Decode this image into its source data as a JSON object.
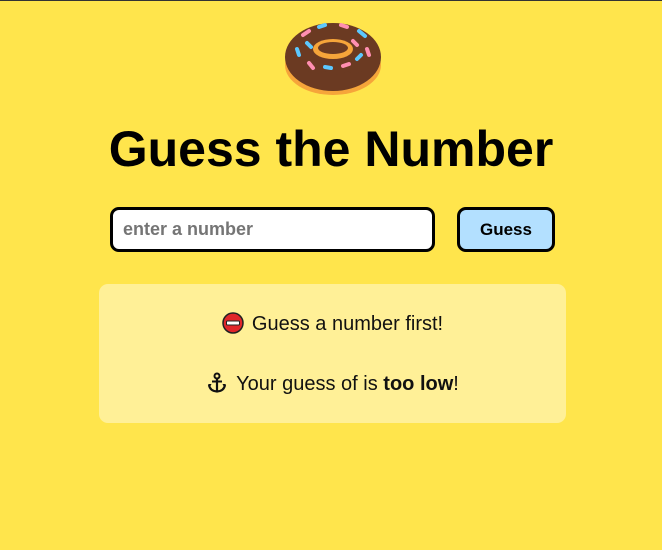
{
  "header": {
    "logo_icon": "donut-icon",
    "title": "Guess the Number"
  },
  "form": {
    "input_placeholder": "enter a number",
    "input_value": "",
    "button_label": "Guess"
  },
  "feedback": {
    "first": {
      "icon": "no-entry-icon",
      "text": "Guess a number first!"
    },
    "second": {
      "icon": "anchor-icon",
      "prefix": "Your guess of is ",
      "emphasis": "too low",
      "suffix": "!"
    }
  },
  "colors": {
    "background": "#ffe54c",
    "panel": "#fff097",
    "button": "#b3e0ff"
  }
}
